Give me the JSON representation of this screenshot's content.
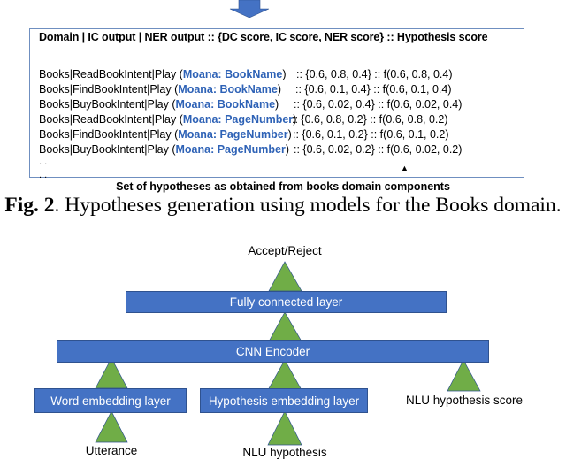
{
  "top_panel": {
    "arrow_icon": "down-arrow",
    "header": "Domain | IC output | NER output :: {DC score, IC score, NER score} :: Hypothesis score",
    "rows": [
      {
        "prefix": "Books|ReadBookIntent|Play (",
        "entity": "Moana: BookName",
        "suffix": ")",
        "scores": ":: {0.6, 0.8, 0.4} :: f(0.6, 0.8, 0.4)"
      },
      {
        "prefix": "Books|FindBookIntent|Play (",
        "entity": "Moana: BookName",
        "suffix": ")",
        "scores": ":: {0.6, 0.1, 0.4} :: f(0.6, 0.1, 0.4)"
      },
      {
        "prefix": "Books|BuyBookIntent|Play (",
        "entity": "Moana: BookName",
        "suffix": ")",
        "scores": ":: {0.6, 0.02, 0.4} :: f(0.6, 0.02, 0.4)"
      },
      {
        "prefix": "Books|ReadBookIntent|Play (",
        "entity": "Moana: PageNumber",
        "suffix": ")",
        "scores": ":: {0.6, 0.8, 0.2} :: f(0.6, 0.8, 0.2)"
      },
      {
        "prefix": "Books|FindBookIntent|Play (",
        "entity": "Moana: PageNumber",
        "suffix": ")",
        "scores": ":: {0.6, 0.1, 0.2} :: f(0.6, 0.1, 0.2)"
      },
      {
        "prefix": "Books|BuyBookIntent|Play (",
        "entity": "Moana: PageNumber",
        "suffix": ")",
        "scores": ":: {0.6, 0.02, 0.2} :: f(0.6, 0.02, 0.2)"
      }
    ],
    "ellipsis": [
      ". .",
      ". ."
    ],
    "sub_caption": "Set of hypotheses as obtained from books domain components"
  },
  "figure_caption": {
    "label": "Fig. 2",
    "text": ". Hypotheses generation using models for the Books domain."
  },
  "network": {
    "output_label": "Accept/Reject",
    "layers": {
      "fully_connected": "Fully connected layer",
      "cnn_encoder": "CNN Encoder",
      "word_embedding": "Word embedding layer",
      "hypothesis_embedding": "Hypothesis embedding layer"
    },
    "inputs": {
      "utterance": "Utterance",
      "nlu_hypothesis": "NLU hypothesis",
      "nlu_hypothesis_score": "NLU hypothesis score"
    },
    "colors": {
      "layer_fill": "#4472c4",
      "layer_border": "#2f528f",
      "arrow_fill": "#70ad47",
      "arrow_border": "#2f528f",
      "entity_text": "#2e62b6"
    }
  }
}
